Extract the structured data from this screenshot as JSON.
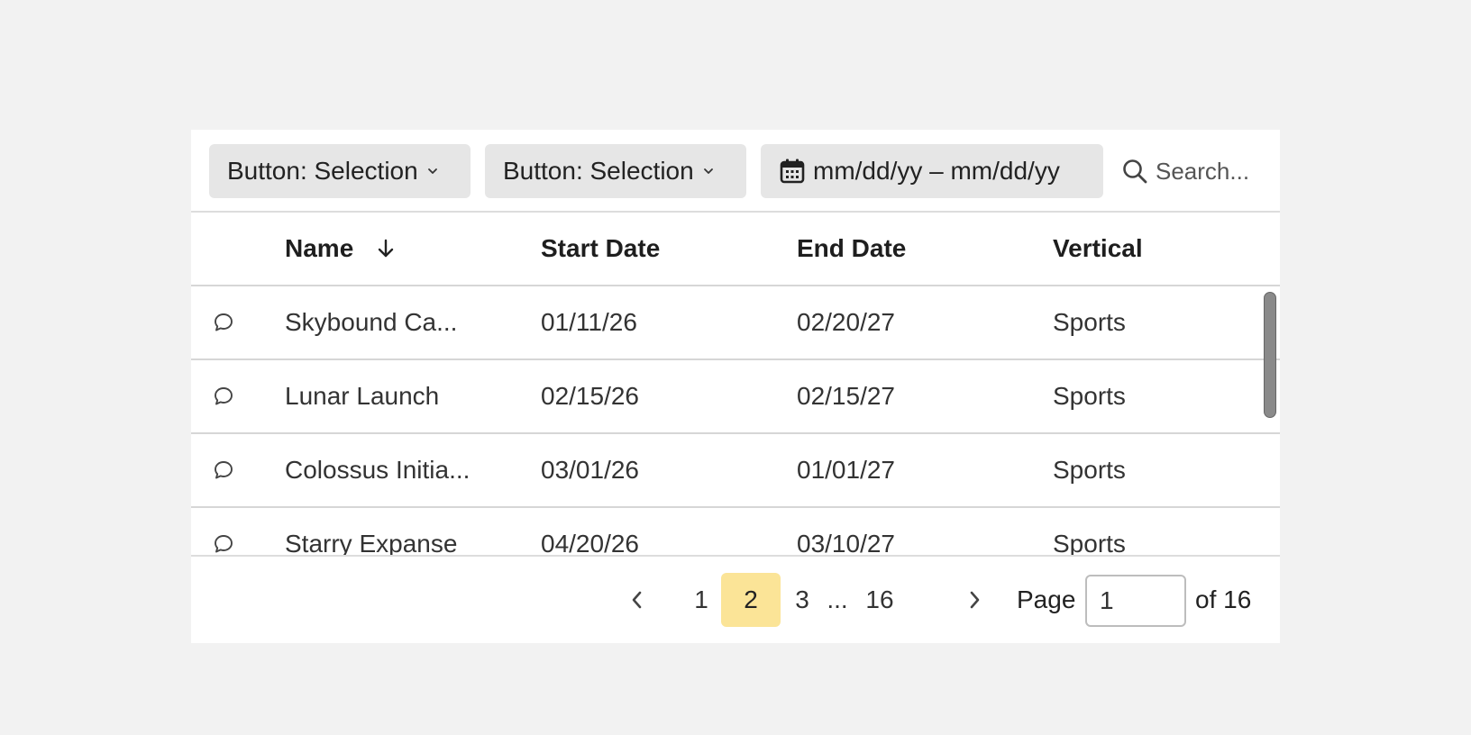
{
  "toolbar": {
    "filter1_label": "Button: Selection",
    "filter2_label": "Button: Selection",
    "date_range_label": "mm/dd/yy – mm/dd/yy",
    "search_placeholder": "Search..."
  },
  "table": {
    "columns": [
      {
        "label": "Name",
        "sorted": "descending"
      },
      {
        "label": "Start Date"
      },
      {
        "label": "End Date"
      },
      {
        "label": "Vertical"
      }
    ],
    "rows": [
      {
        "name": "Skybound Ca...",
        "start": "01/11/26",
        "end": "02/20/27",
        "vertical": "Sports",
        "icon": "comment-icon"
      },
      {
        "name": "Lunar Launch",
        "start": "02/15/26",
        "end": "02/15/27",
        "vertical": "Sports",
        "icon": "comment-icon"
      },
      {
        "name": "Colossus Initia...",
        "start": "03/01/26",
        "end": "01/01/27",
        "vertical": "Sports",
        "icon": "comment-icon"
      },
      {
        "name": "Starry Expanse",
        "start": "04/20/26",
        "end": "03/10/27",
        "vertical": "Sports",
        "icon": "comment-icon"
      }
    ]
  },
  "pagination": {
    "pages": [
      "1",
      "2",
      "3",
      "...",
      "16"
    ],
    "current_page": "2",
    "page_label": "Page",
    "page_input_value": "1",
    "of_label": "of 16"
  },
  "colors": {
    "background": "#f2f2f2",
    "button_bg": "#e6e6e6",
    "active_page": "#fbe497"
  }
}
